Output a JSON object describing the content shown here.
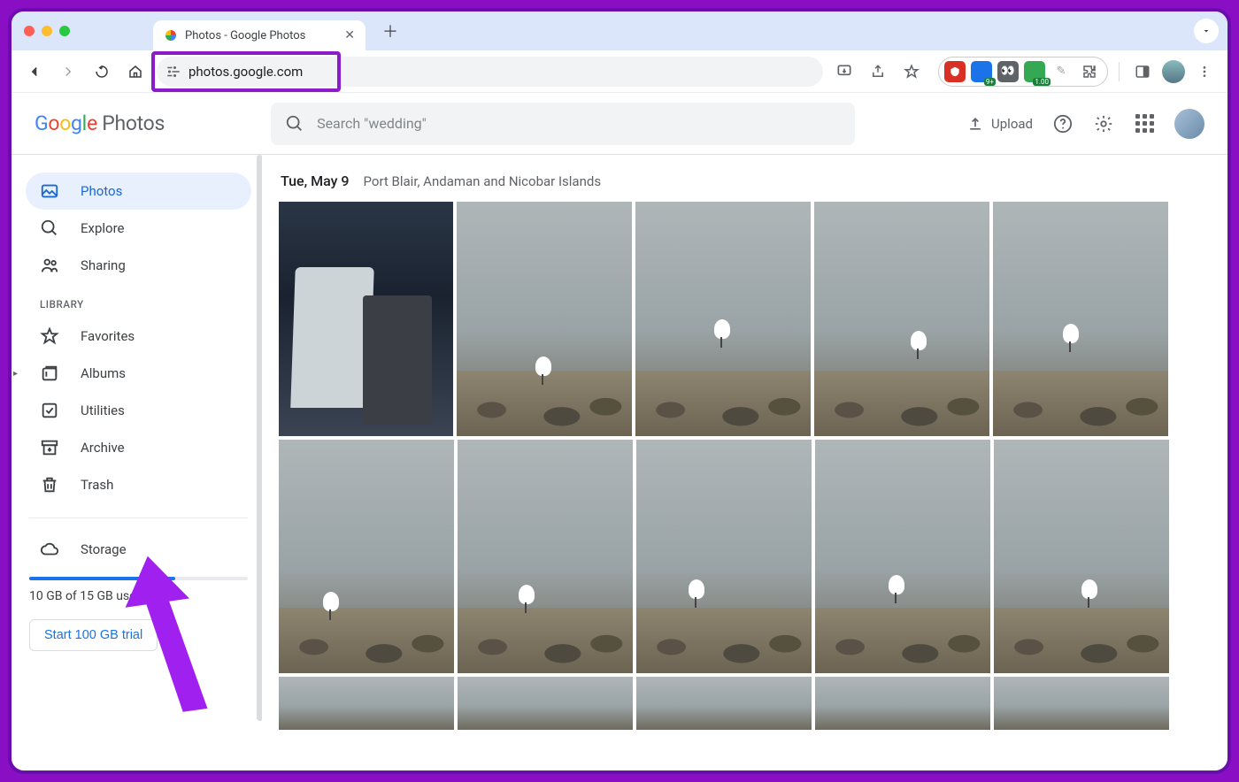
{
  "browser": {
    "tab_title": "Photos - Google Photos",
    "url": "photos.google.com",
    "extension_badge": "9+",
    "extension_badge2": "1.00"
  },
  "app": {
    "logo_product": "Photos",
    "search_placeholder": "Search \"wedding\"",
    "upload_label": "Upload"
  },
  "sidebar": {
    "items": [
      {
        "label": "Photos"
      },
      {
        "label": "Explore"
      },
      {
        "label": "Sharing"
      }
    ],
    "library_label": "LIBRARY",
    "library_items": [
      {
        "label": "Favorites"
      },
      {
        "label": "Albums"
      },
      {
        "label": "Utilities"
      },
      {
        "label": "Archive"
      },
      {
        "label": "Trash"
      }
    ],
    "storage_label": "Storage",
    "storage_used_text": "10 GB of 15 GB used",
    "trial_button": "Start 100 GB trial"
  },
  "content": {
    "date": "Tue, May 9",
    "location": "Port Blair, Andaman and Nicobar Islands"
  }
}
